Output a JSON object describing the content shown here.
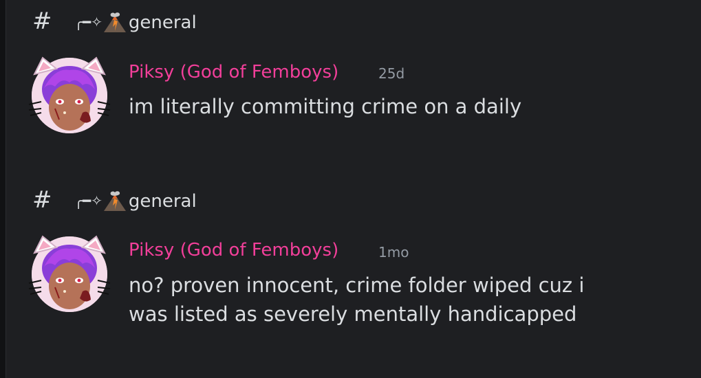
{
  "messages": [
    {
      "channel": {
        "hash": "#",
        "prefix": "╭━✧",
        "name": "general"
      },
      "author": "Piksy (God of Femboys)",
      "timestamp": "25d",
      "lines": [
        "im literally committing crime on a daily"
      ]
    },
    {
      "channel": {
        "hash": "#",
        "prefix": "╭━✧",
        "name": "general"
      },
      "author": "Piksy (God of Femboys)",
      "timestamp": "1mo",
      "lines": [
        "no? proven innocent, crime folder wiped cuz i",
        "was listed as severely mentally handicapped"
      ]
    }
  ],
  "colors": {
    "background": "#1e1f22",
    "username": "#f23f9a",
    "text": "#dbdee1",
    "timestamp": "#949ba4"
  },
  "icons": {
    "channel": "hash-icon",
    "emoji": "volcano-emoji"
  }
}
